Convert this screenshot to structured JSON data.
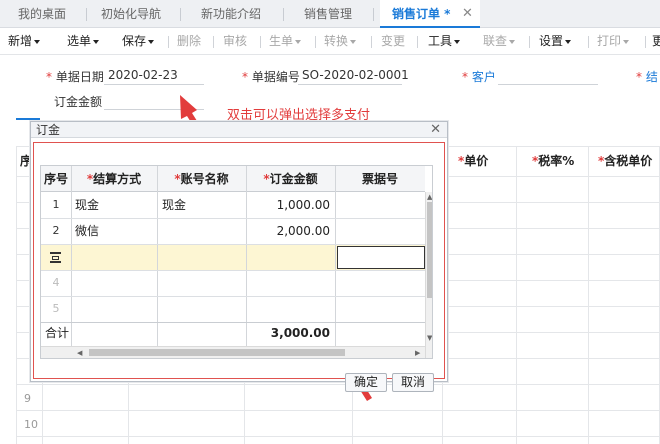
{
  "tabs": [
    {
      "label": "我的桌面"
    },
    {
      "label": "初始化导航"
    },
    {
      "label": "新功能介绍"
    },
    {
      "label": "销售管理"
    },
    {
      "label": "销售订单 *"
    }
  ],
  "toolbar": {
    "items": [
      {
        "label": "新增"
      },
      {
        "label": "选单"
      },
      {
        "label": "保存"
      },
      {
        "label": "删除"
      },
      {
        "label": "审核"
      },
      {
        "label": "生单"
      },
      {
        "label": "转换"
      },
      {
        "label": "变更"
      },
      {
        "label": "工具"
      },
      {
        "label": "联查"
      },
      {
        "label": "设置"
      },
      {
        "label": "打印"
      },
      {
        "label": "更"
      }
    ]
  },
  "form": {
    "date_label": "单据日期",
    "date_value": "2020-02-23",
    "code_label": "单据编号",
    "code_value": "SO-2020-02-0001",
    "customer_label": "客户",
    "settle_label": "结",
    "amount_label": "订金金额"
  },
  "annotation": "双击可以弹出选择多支付",
  "background_grid": {
    "col_first": "序",
    "headers": [
      "单价",
      "税率%",
      "含税单价"
    ],
    "row_numbers": [
      "9",
      "10"
    ]
  },
  "dialog": {
    "title": "订金",
    "columns": [
      "序号",
      "结算方式",
      "账号名称",
      "订金金额",
      "票据号"
    ],
    "rows": [
      {
        "no": "1",
        "method": "现金",
        "account": "现金",
        "amount": "1,000.00",
        "ticket": ""
      },
      {
        "no": "2",
        "method": "微信",
        "account": "",
        "amount": "2,000.00",
        "ticket": ""
      }
    ],
    "empty_rows": [
      "4",
      "5"
    ],
    "total_label": "合计",
    "total_amount": "3,000.00",
    "ok_label": "确定",
    "cancel_label": "取消"
  }
}
